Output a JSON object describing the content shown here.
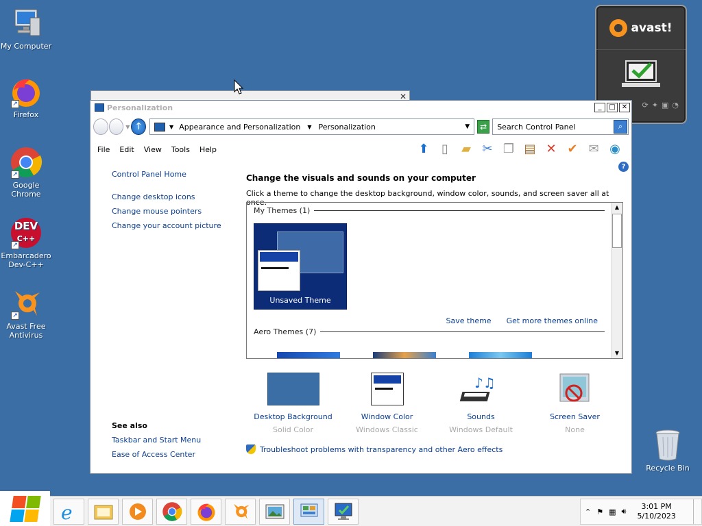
{
  "desktop": {
    "icons": [
      {
        "label": "My Computer"
      },
      {
        "label": "Firefox"
      },
      {
        "label": "Google Chrome"
      },
      {
        "label": "Embarcadero Dev-C++"
      },
      {
        "label": "Avast Free Antivirus"
      }
    ],
    "recycle_bin": "Recycle Bin",
    "dev_icon_text": "DEV",
    "dev_icon_sub": "C++"
  },
  "avast": {
    "brand": "avast!"
  },
  "window": {
    "title": "Personalization",
    "minimize": "_",
    "maximize": "□",
    "close": "✕",
    "breadcrumb": [
      "Appearance and Personalization",
      "Personalization"
    ],
    "search_placeholder": "Search Control Panel",
    "menu": [
      "File",
      "Edit",
      "View",
      "Tools",
      "Help"
    ],
    "help": "?",
    "left_links": [
      "Control Panel Home",
      "Change desktop icons",
      "Change mouse pointers",
      "Change your account picture"
    ],
    "see_also_title": "See also",
    "see_also_links": [
      "Taskbar and Start Menu",
      "Ease of Access Center"
    ],
    "main_title": "Change the visuals and sounds on your computer",
    "main_desc": "Click a theme to change the desktop background, window color, sounds, and screen saver all at once.",
    "my_themes_header": "My Themes (1)",
    "unsaved_theme": "Unsaved Theme",
    "save_theme": "Save theme",
    "get_more_themes": "Get more themes online",
    "aero_header": "Aero Themes (7)",
    "customizations": [
      {
        "label": "Desktop Background",
        "sub": "Solid Color"
      },
      {
        "label": "Window Color",
        "sub": "Windows Classic"
      },
      {
        "label": "Sounds",
        "sub": "Windows Default"
      },
      {
        "label": "Screen Saver",
        "sub": "None"
      }
    ],
    "troubleshoot": "Troubleshoot problems with transparency and other Aero effects"
  },
  "taskbar": {
    "time": "3:01 PM",
    "date": "5/10/2023"
  },
  "colors": {
    "desktop": "#3a6ea5",
    "link": "#0a3d8f",
    "theme_tile": "#0c2c78"
  }
}
